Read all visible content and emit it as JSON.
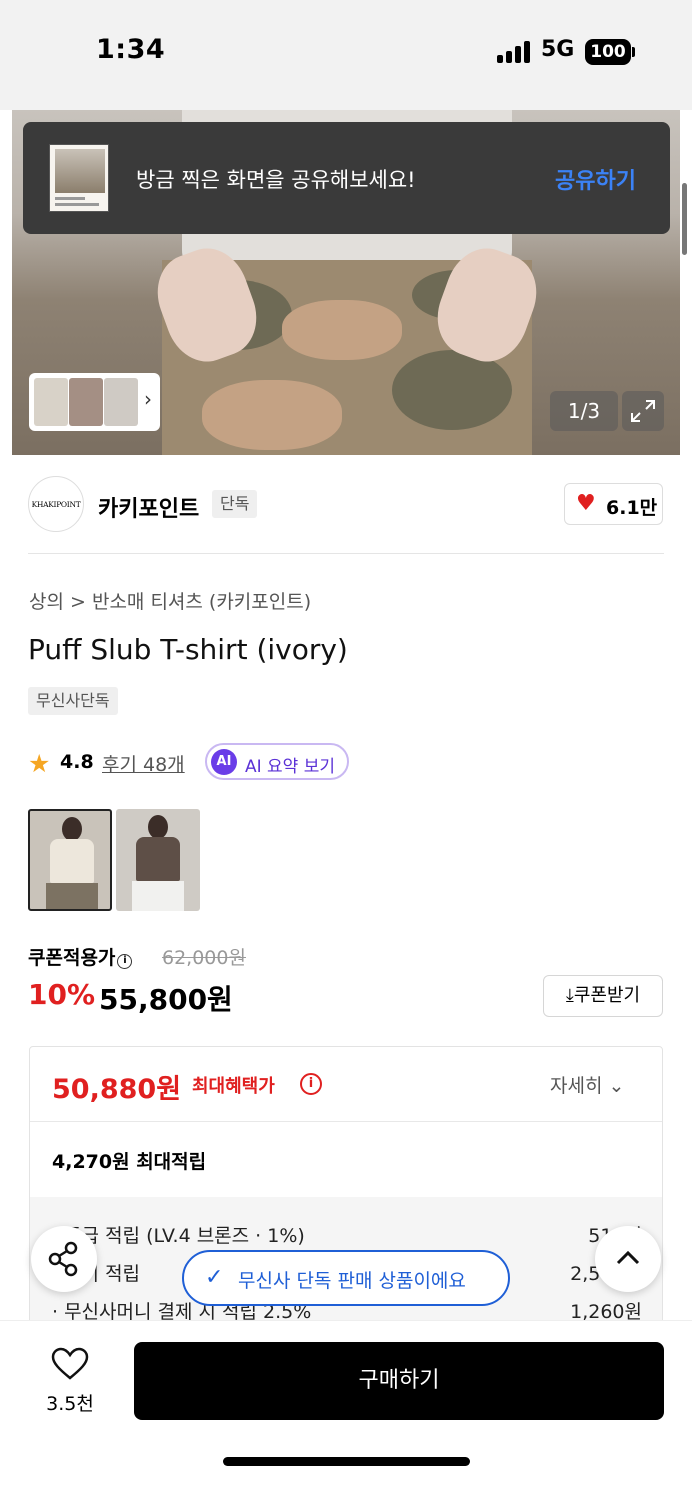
{
  "status_bar": {
    "time": "1:34",
    "network": "5G",
    "battery": "100"
  },
  "hero": {
    "counter": "1/3"
  },
  "toast": {
    "message": "방금 찍은 화면을 공유해보세요!",
    "action": "공유하기"
  },
  "brand": {
    "logo_text": "KHAKIPOINT",
    "name": "카키포인트",
    "badge": "단독",
    "likes": "6.1만"
  },
  "product": {
    "breadcrumb": "상의 > 반소매 티셔츠 (카키포인트)",
    "title": "Puff Slub T-shirt (ivory)",
    "exclusive_badge": "무신사단독",
    "rating": "4.8",
    "reviews": "후기 48개",
    "ai_icon": "AI",
    "ai_summary": "AI 요약 보기"
  },
  "price": {
    "coupon_label": "쿠폰적용가",
    "original": "62,000원",
    "discount": "10%",
    "sale": "55,800원",
    "coupon_button": "쿠폰받기"
  },
  "benefits": {
    "max_price": "50,880원",
    "max_label": "최대혜택가",
    "detail": "자세히",
    "points_total": "4,270원 최대적립",
    "rows": [
      {
        "label": "· 등급 적립 (LV.4 브론즈 · 1%)",
        "value": "510원"
      },
      {
        "label": "· 후기 적립",
        "value": "2,500원"
      },
      {
        "label": "· 무신사머니 결제 시 적립 2.5%",
        "value": "1,260원"
      }
    ]
  },
  "floating": {
    "exclusive_notice": "무신사 단독 판매 상품이에요"
  },
  "bottom_bar": {
    "wishlist_count": "3.5천",
    "buy_label": "구매하기"
  },
  "colors": {
    "accent_red": "#e02020",
    "link_blue": "#3b82f6",
    "ai_purple": "#6a3de8",
    "pill_blue": "#1f5fd6"
  }
}
